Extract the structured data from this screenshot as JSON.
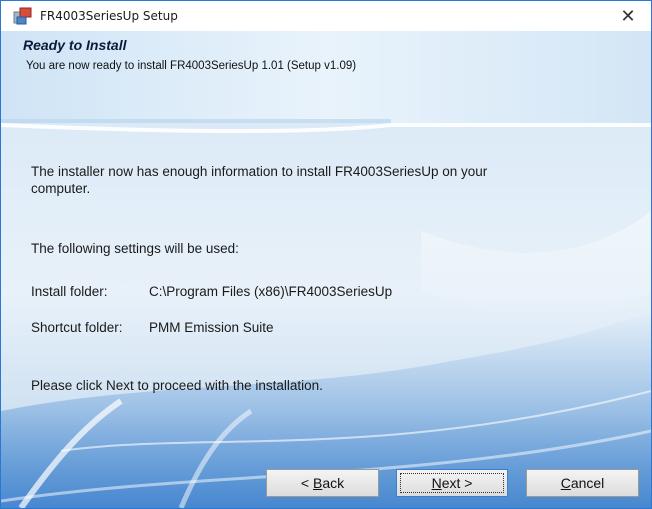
{
  "window": {
    "title": "FR4003SeriesUp Setup",
    "close_label": "✕"
  },
  "header": {
    "heading": "Ready to Install",
    "subheading": "You are now ready to install FR4003SeriesUp 1.01 (Setup v1.09)"
  },
  "content": {
    "intro_line1": "The installer now has enough information to install FR4003SeriesUp on your",
    "intro_line2": "computer.",
    "settings_heading": "The following settings will be used:",
    "install_folder_label": "Install folder:",
    "install_folder_value": "C:\\Program Files (x86)\\FR4003SeriesUp",
    "shortcut_folder_label": "Shortcut folder:",
    "shortcut_folder_value": "PMM Emission Suite",
    "instruction": "Please click Next to proceed with the installation."
  },
  "buttons": {
    "back_prefix": "< ",
    "back_hotkey": "B",
    "back_rest": "ack",
    "next_hotkey": "N",
    "next_rest": "ext >",
    "cancel_hotkey": "C",
    "cancel_rest": "ancel"
  },
  "colors": {
    "accent": "#2b78d4",
    "background": "#ddebf7"
  }
}
